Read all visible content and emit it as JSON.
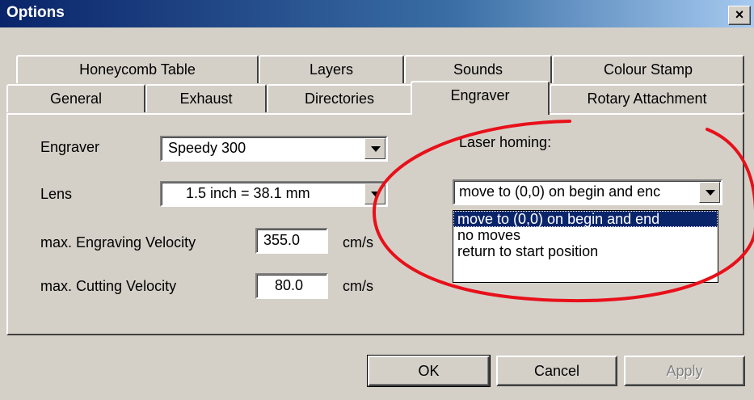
{
  "window": {
    "title": "Options",
    "close_glyph": "×"
  },
  "tabs_row1": [
    "Honeycomb Table",
    "Layers",
    "Sounds",
    "Colour Stamp"
  ],
  "tabs_row2": [
    "General",
    "Exhaust",
    "Directories",
    "Engraver",
    "Rotary Attachment"
  ],
  "active_tab": "Engraver",
  "engraver": {
    "engraver_label": "Engraver",
    "engraver_value": "Speedy 300",
    "lens_label": "Lens",
    "lens_value": "1.5 inch = 38.1 mm",
    "eng_vel_label": "max. Engraving Velocity",
    "eng_vel_value": "355.0",
    "eng_vel_unit": "cm/s",
    "cut_vel_label": "max. Cutting Velocity",
    "cut_vel_value": "80.0",
    "cut_vel_unit": "cm/s",
    "homing_label": "Laser homing:",
    "homing_value": "move to (0,0) on begin and enc",
    "homing_options": [
      "move to (0,0) on begin and end",
      "no moves",
      "return to start position"
    ]
  },
  "buttons": {
    "ok": "OK",
    "cancel": "Cancel",
    "apply": "Apply"
  },
  "annotation_color": "#e8101a"
}
